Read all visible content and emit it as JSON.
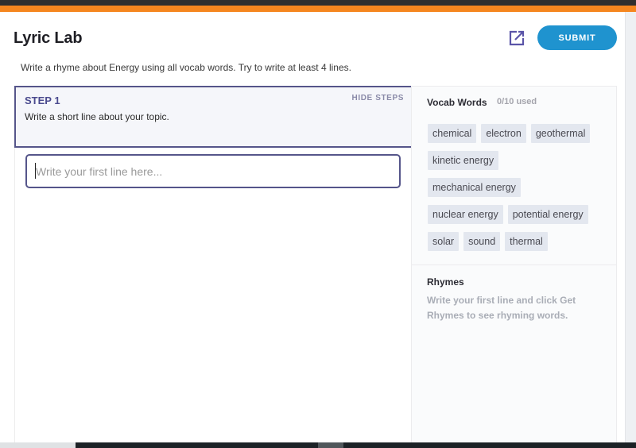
{
  "app": {
    "title": "Lyric Lab",
    "submit_label": "SUBMIT",
    "open_external_icon": "external-link-icon",
    "instructions": "Write a rhyme about Energy using all vocab words. Try to write at least 4 lines."
  },
  "step": {
    "label": "STEP 1",
    "hide_label": "HIDE STEPS",
    "description": "Write a short line about your topic."
  },
  "line_input": {
    "value": "",
    "placeholder": "Write your first line here..."
  },
  "vocab": {
    "heading": "Vocab Words",
    "count": "0/10 used",
    "words": [
      "chemical",
      "electron",
      "geothermal",
      "kinetic energy",
      "mechanical energy",
      "nuclear energy",
      "potential energy",
      "solar",
      "sound",
      "thermal"
    ]
  },
  "rhymes": {
    "heading": "Rhymes",
    "hint": "Write your first line and click Get Rhymes to see rhyming words."
  },
  "colors": {
    "accent_orange": "#f5861f",
    "submit_blue": "#1f93cf",
    "step_border": "#55558a"
  }
}
